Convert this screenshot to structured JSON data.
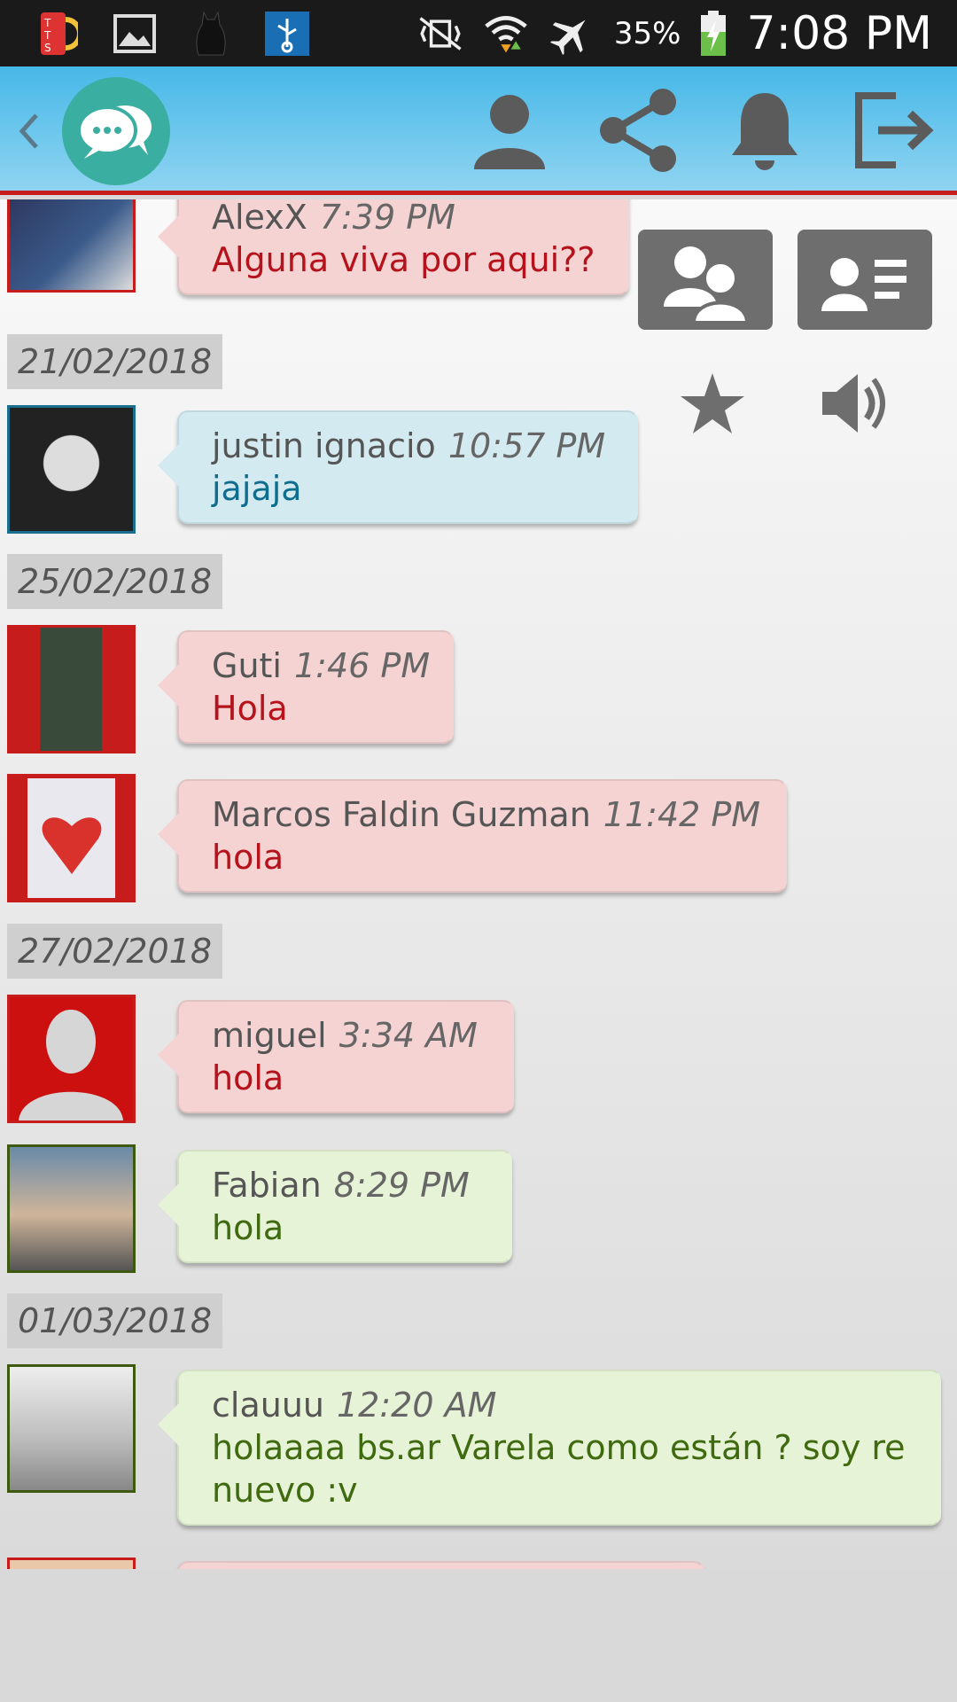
{
  "status_bar": {
    "battery_percent": "35%",
    "time": "7:08 PM",
    "icons": [
      "tts-icon",
      "image-icon",
      "cat-icon",
      "usb-icon",
      "vibrate-off-icon",
      "wifi-icon",
      "airplane-icon",
      "battery-charging-icon"
    ]
  },
  "app_bar": {
    "icons": [
      "back-icon",
      "chat-logo-icon",
      "profile-icon",
      "share-icon",
      "bell-icon",
      "exit-icon"
    ]
  },
  "overlay_buttons": [
    "users-icon",
    "contact-card-icon",
    "star-icon",
    "speaker-icon"
  ],
  "messages": [
    {
      "type": "msg",
      "name": "AlexX",
      "time": "7:39 PM",
      "text": "Alguna viva por aqui??",
      "color": "red"
    },
    {
      "type": "date",
      "date": "21/02/2018"
    },
    {
      "type": "msg",
      "name": "justin ignacio",
      "time": "10:57 PM",
      "text": "jajaja",
      "color": "blue"
    },
    {
      "type": "date",
      "date": "25/02/2018"
    },
    {
      "type": "msg",
      "name": "Guti",
      "time": "1:46 PM",
      "text": "Hola",
      "color": "red"
    },
    {
      "type": "msg",
      "name": "Marcos Faldin Guzman",
      "time": "11:42 PM",
      "text": "hola",
      "color": "red"
    },
    {
      "type": "date",
      "date": "27/02/2018"
    },
    {
      "type": "msg",
      "name": "miguel",
      "time": "3:34 AM",
      "text": "hola",
      "color": "red"
    },
    {
      "type": "msg",
      "name": "Fabian",
      "time": "8:29 PM",
      "text": "hola",
      "color": "green"
    },
    {
      "type": "date",
      "date": "01/03/2018"
    },
    {
      "type": "msg",
      "name": "clauuu",
      "time": "12:20 AM",
      "text": "holaaaa bs.ar Varela como están ? soy re nuevo :v",
      "color": "green"
    }
  ],
  "colors": {
    "red": "#c71c1c",
    "blue": "#2a6f8f",
    "green": "#3d5a10",
    "appbar": "#47b8e8"
  }
}
